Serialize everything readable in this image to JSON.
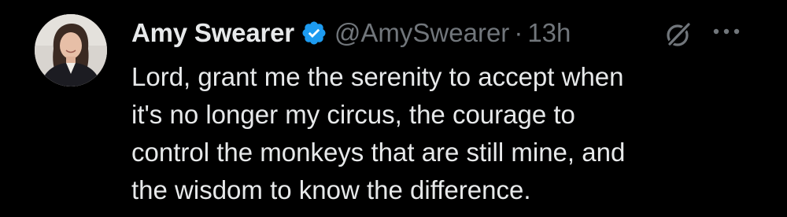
{
  "tweet": {
    "author": {
      "display_name": "Amy Swearer",
      "handle": "@AmySwearer",
      "verified": true
    },
    "separator": "·",
    "timestamp": "13h",
    "text_lines": [
      "Lord, grant me the serenity to accept when",
      "it's no longer my circus, the courage to",
      "control the monkeys that are still mine, and",
      "the wisdom to know the difference."
    ],
    "icons": {
      "avatar": "avatar",
      "verified": "verified-badge-icon",
      "grok": "grok-icon",
      "more": "more-options-icon"
    }
  },
  "colors": {
    "background": "#000000",
    "primary_text": "#e7e9ea",
    "secondary_text": "#71767b",
    "verified_blue": "#1d9bf0"
  }
}
